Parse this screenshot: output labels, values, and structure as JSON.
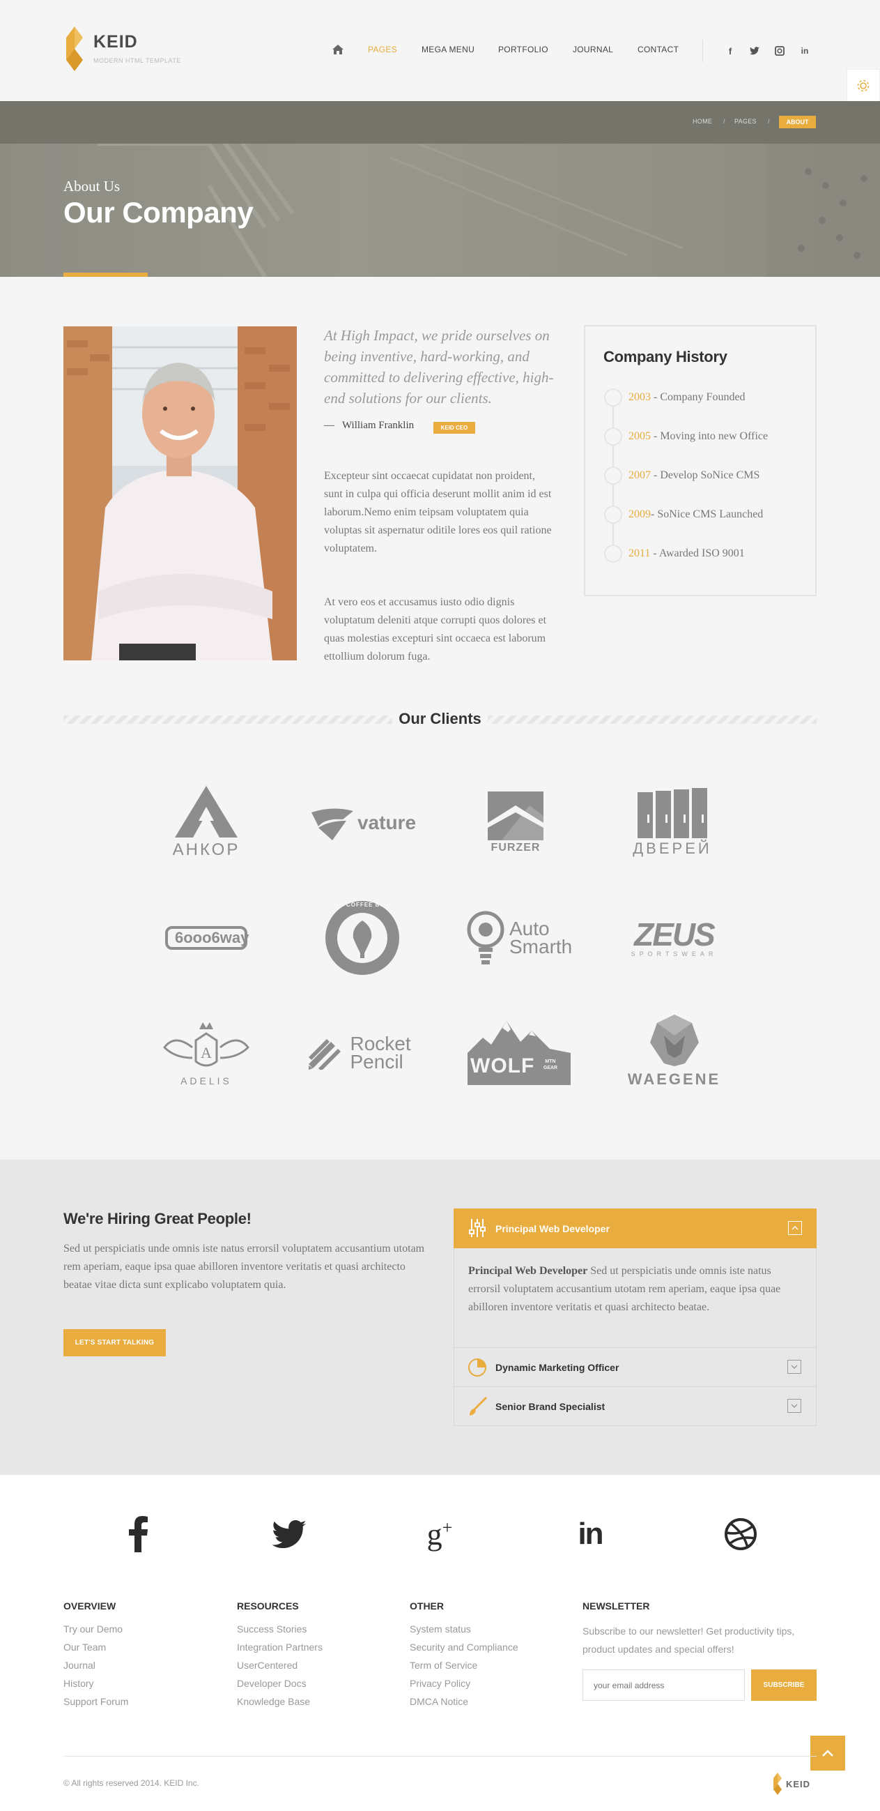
{
  "brand": {
    "name": "KEID",
    "tagline": "MODERN HTML TEMPLATE",
    "accent": "#e8ac3f"
  },
  "nav": {
    "home_icon": "home-icon",
    "items": [
      {
        "label": "PAGES",
        "active": true
      },
      {
        "label": "MEGA MENU",
        "active": false
      },
      {
        "label": "PORTFOLIO",
        "active": false
      },
      {
        "label": "JOURNAL",
        "active": false
      },
      {
        "label": "CONTACT",
        "active": false
      }
    ],
    "social": [
      "facebook-icon",
      "twitter-icon",
      "instagram-icon",
      "linkedin-icon"
    ]
  },
  "breadcrumb": {
    "items": [
      "HOME",
      "PAGES"
    ],
    "current": "ABOUT"
  },
  "banner": {
    "subtitle": "About Us",
    "title": "Our Company"
  },
  "about": {
    "quote": "At High Impact, we pride ourselves on being inventive, hard-working, and committed to delivering effective, high-end solutions for our clients.",
    "author": "William Franklin",
    "author_prefix": "—",
    "badge": "KEID CEO",
    "paragraphs": [
      "Excepteur sint occaecat cupidatat non proident, sunt in culpa qui officia deserunt mollit anim id est laborum.Nemo enim teipsam voluptatem quia voluptas sit aspernatur oditile lores eos quil ratione voluptatem.",
      "At vero eos et accusamus iusto odio dignis voluptatum deleniti atque corrupti quos dolores et quas molestias excepturi sint occaeca est laborum ettollium dolorum fuga."
    ]
  },
  "history": {
    "title": "Company History",
    "events": [
      {
        "year": "2003",
        "text": " - Company Founded"
      },
      {
        "year": "2005",
        "text": " - Moving into new Office"
      },
      {
        "year": "2007",
        "text": " - Develop SoNice CMS"
      },
      {
        "year": "2009",
        "text": "- SoNice CMS Launched"
      },
      {
        "year": "2011",
        "text": " - Awarded ISO 9001"
      }
    ]
  },
  "clients": {
    "title": "Our Clients",
    "logos": [
      {
        "name": "АНКОР"
      },
      {
        "name": "vature"
      },
      {
        "name": "FURZER"
      },
      {
        "name": "ДВЕРЕЙ"
      },
      {
        "name": "6ooo6way"
      },
      {
        "name": "THE COFFEE BUSH"
      },
      {
        "name": "Auto Smarth"
      },
      {
        "name": "ZEUS",
        "sub": "SPORTSWEAR"
      },
      {
        "name": "ADELIS"
      },
      {
        "name": "Rocket Pencil"
      },
      {
        "name": "WOLF",
        "sub": "MTN GEAR"
      },
      {
        "name": "WAEGENE"
      }
    ]
  },
  "hiring": {
    "title": "We're Hiring Great People!",
    "text": "Sed ut perspiciatis unde omnis iste natus errorsil voluptatem accusantium utotam rem aperiam, eaque ipsa quae abilloren inventore veritatis et quasi architecto beatae vitae dicta sunt explicabo voluptatem quia.",
    "button": "LET'S START TALKING",
    "jobs": [
      {
        "title": "Principal Web Developer",
        "icon": "sliders-icon",
        "open": true,
        "body_lead": "Principal Web Developer",
        "body": " Sed ut perspiciatis unde omnis iste natus errorsil voluptatem accusantium utotam rem aperiam, eaque ipsa quae abilloren inventore veritatis et quasi architecto beatae."
      },
      {
        "title": "Dynamic Marketing Officer",
        "icon": "pie-chart-icon",
        "open": false
      },
      {
        "title": "Senior Brand Specialist",
        "icon": "brush-icon",
        "open": false
      }
    ]
  },
  "footer": {
    "social": [
      "facebook-icon",
      "twitter-icon",
      "google-plus-icon",
      "linkedin-icon",
      "dribbble-icon"
    ],
    "columns": [
      {
        "title": "OVERVIEW",
        "links": [
          "Try our Demo",
          "Our Team",
          "Journal",
          "History",
          "Support Forum"
        ]
      },
      {
        "title": "RESOURCES",
        "links": [
          "Success Stories",
          "Integration Partners",
          "UserCentered",
          "Developer Docs",
          "Knowledge Base"
        ]
      },
      {
        "title": "OTHER",
        "links": [
          "System status",
          "Security and Compliance",
          "Term of Service",
          "Privacy Policy",
          "DMCA Notice"
        ]
      }
    ],
    "newsletter": {
      "title": "NEWSLETTER",
      "text": "Subscribe to our newsletter! Get productivity tips, product updates and special offers!",
      "placeholder": "your email address",
      "button": "SUBSCRIBE"
    },
    "copyright": "© All rights reserved 2014. KEID Inc.",
    "logo_text": "KEID"
  }
}
